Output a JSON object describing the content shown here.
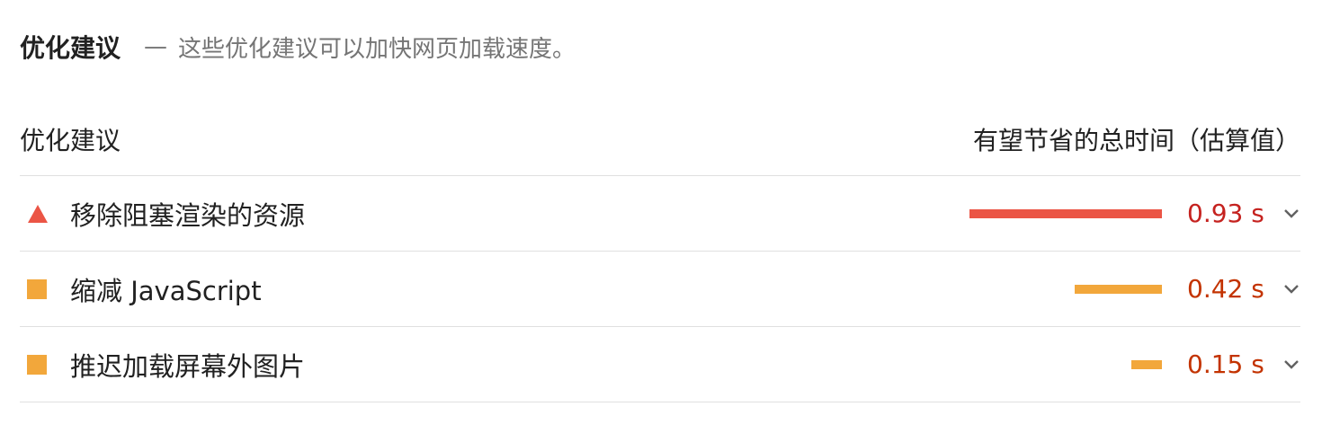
{
  "header": {
    "title": "优化建议",
    "separator": "—",
    "description": "这些优化建议可以加快网页加载速度。"
  },
  "table": {
    "col_opportunity": "优化建议",
    "col_savings": "有望节省的总时间（估算值）",
    "max_savings_seconds": 1.13,
    "rows": [
      {
        "title": "移除阻塞渲染的资源",
        "value": "0.93 s",
        "savings_seconds": 0.93,
        "severity": "fail",
        "icon": "red-triangle-icon",
        "color": "#eb5545",
        "text_color": "#c5221f"
      },
      {
        "title": "缩减 JavaScript",
        "value": "0.42 s",
        "savings_seconds": 0.42,
        "severity": "average",
        "icon": "orange-square-icon",
        "color": "#f2a73b",
        "text_color": "#c33300"
      },
      {
        "title": "推迟加载屏幕外图片",
        "value": "0.15 s",
        "savings_seconds": 0.15,
        "severity": "average",
        "icon": "orange-square-icon",
        "color": "#f2a73b",
        "text_color": "#c33300"
      }
    ]
  }
}
